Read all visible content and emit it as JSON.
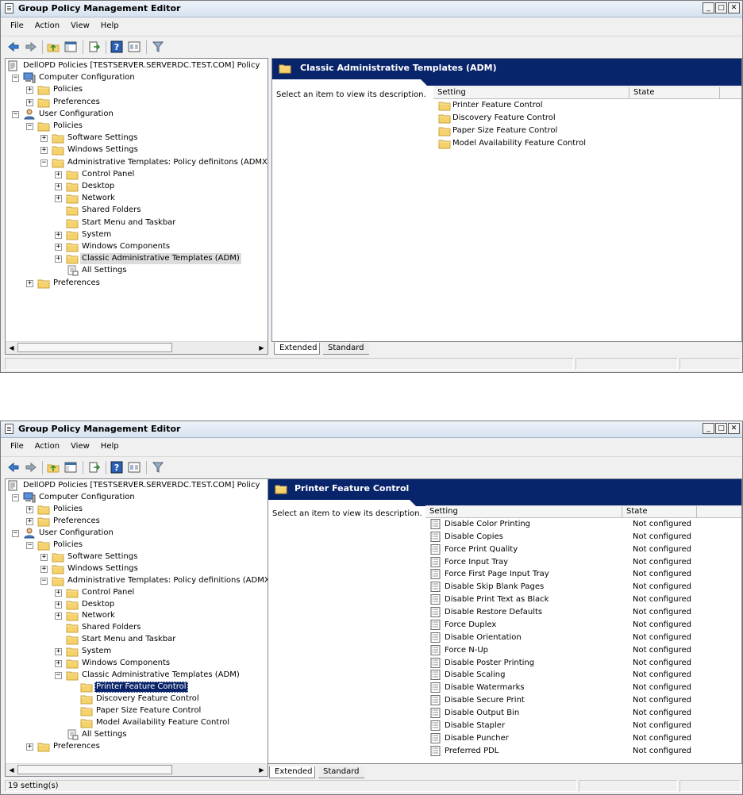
{
  "colors": {
    "header_bg": "#08246b",
    "selection_bg": "#0a246a",
    "folder": "#f5d26b"
  },
  "windows": [
    {
      "title": "Group Policy Management Editor",
      "menu": [
        "File",
        "Action",
        "View",
        "Help"
      ],
      "tree": [
        {
          "label": "DellOPD Policies [TESTSERVER.SERVERDC.TEST.COM] Policy",
          "icon": "policy-doc",
          "level": 0,
          "expander": ""
        },
        {
          "label": "Computer Configuration",
          "icon": "computer",
          "level": 1,
          "expander": "−"
        },
        {
          "label": "Policies",
          "icon": "folder",
          "level": 2,
          "expander": "+"
        },
        {
          "label": "Preferences",
          "icon": "folder",
          "level": 2,
          "expander": "+"
        },
        {
          "label": "User Configuration",
          "icon": "user",
          "level": 1,
          "expander": "−"
        },
        {
          "label": "Policies",
          "icon": "folder",
          "level": 2,
          "expander": "−"
        },
        {
          "label": "Software Settings",
          "icon": "folder",
          "level": 3,
          "expander": "+"
        },
        {
          "label": "Windows Settings",
          "icon": "folder",
          "level": 3,
          "expander": "+"
        },
        {
          "label": "Administrative Templates: Policy definitons (ADMX files)",
          "icon": "folder",
          "level": 3,
          "expander": "−"
        },
        {
          "label": "Control Panel",
          "icon": "folder",
          "level": 4,
          "expander": "+"
        },
        {
          "label": "Desktop",
          "icon": "folder",
          "level": 4,
          "expander": "+"
        },
        {
          "label": "Network",
          "icon": "folder",
          "level": 4,
          "expander": "+"
        },
        {
          "label": "Shared Folders",
          "icon": "folder",
          "level": 4,
          "expander": ""
        },
        {
          "label": "Start Menu and Taskbar",
          "icon": "folder",
          "level": 4,
          "expander": ""
        },
        {
          "label": "System",
          "icon": "folder",
          "level": 4,
          "expander": "+"
        },
        {
          "label": "Windows Components",
          "icon": "folder",
          "level": 4,
          "expander": "+"
        },
        {
          "label": "Classic Administrative Templates (ADM)",
          "icon": "folder",
          "level": 4,
          "expander": "+",
          "state": "gray"
        },
        {
          "label": "All Settings",
          "icon": "all-settings",
          "level": 4,
          "expander": ""
        },
        {
          "label": "Preferences",
          "icon": "folder",
          "level": 2,
          "expander": "+"
        }
      ],
      "header_title": "Classic Administrative Templates (ADM)",
      "description": "Select an item to view its description.",
      "columns": {
        "setting": "Setting",
        "state": "State"
      },
      "rows": [
        {
          "name": "Printer Feature Control",
          "icon": "folder",
          "state": ""
        },
        {
          "name": "Discovery Feature Control",
          "icon": "folder",
          "state": ""
        },
        {
          "name": "Paper Size Feature Control",
          "icon": "folder",
          "state": ""
        },
        {
          "name": "Model Availability Feature Control",
          "icon": "folder",
          "state": ""
        }
      ],
      "tabs": [
        "Extended",
        "Standard"
      ],
      "status": ""
    },
    {
      "title": "Group Policy Management Editor",
      "menu": [
        "File",
        "Action",
        "View",
        "Help"
      ],
      "tree": [
        {
          "label": "DellOPD Policies [TESTSERVER.SERVERDC.TEST.COM] Policy",
          "icon": "policy-doc",
          "level": 0,
          "expander": ""
        },
        {
          "label": "Computer Configuration",
          "icon": "computer",
          "level": 1,
          "expander": "−"
        },
        {
          "label": "Policies",
          "icon": "folder",
          "level": 2,
          "expander": "+"
        },
        {
          "label": "Preferences",
          "icon": "folder",
          "level": 2,
          "expander": "+"
        },
        {
          "label": "User Configuration",
          "icon": "user",
          "level": 1,
          "expander": "−"
        },
        {
          "label": "Policies",
          "icon": "folder",
          "level": 2,
          "expander": "−"
        },
        {
          "label": "Software Settings",
          "icon": "folder",
          "level": 3,
          "expander": "+"
        },
        {
          "label": "Windows Settings",
          "icon": "folder",
          "level": 3,
          "expander": "+"
        },
        {
          "label": "Administrative Templates: Policy definitions (ADMX files)",
          "icon": "folder",
          "level": 3,
          "expander": "−"
        },
        {
          "label": "Control Panel",
          "icon": "folder",
          "level": 4,
          "expander": "+"
        },
        {
          "label": "Desktop",
          "icon": "folder",
          "level": 4,
          "expander": "+"
        },
        {
          "label": "Network",
          "icon": "folder",
          "level": 4,
          "expander": "+"
        },
        {
          "label": "Shared Folders",
          "icon": "folder",
          "level": 4,
          "expander": ""
        },
        {
          "label": "Start Menu and Taskbar",
          "icon": "folder",
          "level": 4,
          "expander": ""
        },
        {
          "label": "System",
          "icon": "folder",
          "level": 4,
          "expander": "+"
        },
        {
          "label": "Windows Components",
          "icon": "folder",
          "level": 4,
          "expander": "+"
        },
        {
          "label": "Classic Administrative Templates (ADM)",
          "icon": "folder",
          "level": 4,
          "expander": "−"
        },
        {
          "label": "Printer Feature Control",
          "icon": "folder",
          "level": 5,
          "expander": "",
          "state": "selected"
        },
        {
          "label": "Discovery Feature Control",
          "icon": "folder",
          "level": 5,
          "expander": ""
        },
        {
          "label": "Paper Size Feature Control",
          "icon": "folder",
          "level": 5,
          "expander": ""
        },
        {
          "label": "Model Availability Feature Control",
          "icon": "folder",
          "level": 5,
          "expander": ""
        },
        {
          "label": "All Settings",
          "icon": "all-settings",
          "level": 4,
          "expander": ""
        },
        {
          "label": "Preferences",
          "icon": "folder",
          "level": 2,
          "expander": "+"
        }
      ],
      "header_title": "Printer Feature Control",
      "description": "Select an item to view its description.",
      "columns": {
        "setting": "Setting",
        "state": "State"
      },
      "rows": [
        {
          "name": "Disable Color Printing",
          "icon": "setting",
          "state": "Not configured"
        },
        {
          "name": "Disable Copies",
          "icon": "setting",
          "state": "Not configured"
        },
        {
          "name": "Force Print Quality",
          "icon": "setting",
          "state": "Not configured"
        },
        {
          "name": "Force Input Tray",
          "icon": "setting",
          "state": "Not configured"
        },
        {
          "name": "Force First Page Input Tray",
          "icon": "setting",
          "state": "Not configured"
        },
        {
          "name": "Disable Skip Blank Pages",
          "icon": "setting",
          "state": "Not configured"
        },
        {
          "name": "Disable Print Text as Black",
          "icon": "setting",
          "state": "Not configured"
        },
        {
          "name": "Disable Restore Defaults",
          "icon": "setting",
          "state": "Not configured"
        },
        {
          "name": "Force Duplex",
          "icon": "setting",
          "state": "Not configured"
        },
        {
          "name": "Disable Orientation",
          "icon": "setting",
          "state": "Not configured"
        },
        {
          "name": "Force N-Up",
          "icon": "setting",
          "state": "Not configured"
        },
        {
          "name": "Disable Poster Printing",
          "icon": "setting",
          "state": "Not configured"
        },
        {
          "name": "Disable Scaling",
          "icon": "setting",
          "state": "Not configured"
        },
        {
          "name": "Disable Watermarks",
          "icon": "setting",
          "state": "Not configured"
        },
        {
          "name": "Disable Secure Print",
          "icon": "setting",
          "state": "Not configured"
        },
        {
          "name": "Disable Output Bin",
          "icon": "setting",
          "state": "Not configured"
        },
        {
          "name": "Disable Stapler",
          "icon": "setting",
          "state": "Not configured"
        },
        {
          "name": "Disable Puncher",
          "icon": "setting",
          "state": "Not configured"
        },
        {
          "name": "Preferred PDL",
          "icon": "setting",
          "state": "Not configured"
        }
      ],
      "tabs": [
        "Extended",
        "Standard"
      ],
      "status": "19 setting(s)"
    }
  ]
}
